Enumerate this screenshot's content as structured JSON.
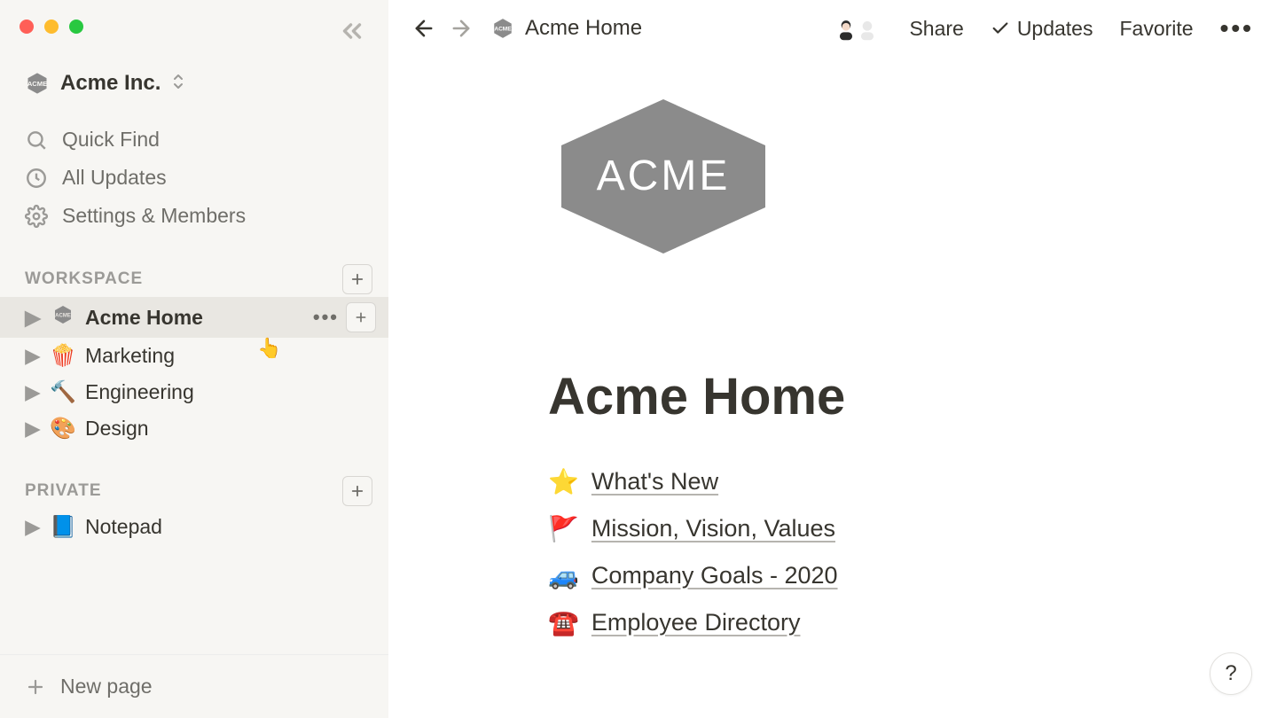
{
  "workspace": {
    "name": "Acme Inc.",
    "logo_label": "ACME"
  },
  "sidebar": {
    "quick_find": "Quick Find",
    "all_updates": "All Updates",
    "settings": "Settings & Members",
    "sections": {
      "workspace_label": "WORKSPACE",
      "private_label": "PRIVATE"
    },
    "workspace_pages": [
      {
        "label": "Acme Home",
        "icon": "acme-badge",
        "active": true
      },
      {
        "label": "Marketing",
        "icon": "🍿"
      },
      {
        "label": "Engineering",
        "icon": "🔨"
      },
      {
        "label": "Design",
        "icon": "🎨"
      }
    ],
    "private_pages": [
      {
        "label": "Notepad",
        "icon": "📘"
      }
    ],
    "new_page": "New page"
  },
  "topbar": {
    "breadcrumb": "Acme Home",
    "share": "Share",
    "updates": "Updates",
    "favorite": "Favorite"
  },
  "page": {
    "title": "Acme Home",
    "logo_text": "ACME",
    "links": [
      {
        "icon": "⭐",
        "label": "What's New"
      },
      {
        "icon": "🚩",
        "label": "Mission, Vision, Values"
      },
      {
        "icon": "🚙",
        "label": "Company Goals - 2020"
      },
      {
        "icon": "☎️",
        "label": "Employee Directory"
      }
    ]
  },
  "help": "?"
}
